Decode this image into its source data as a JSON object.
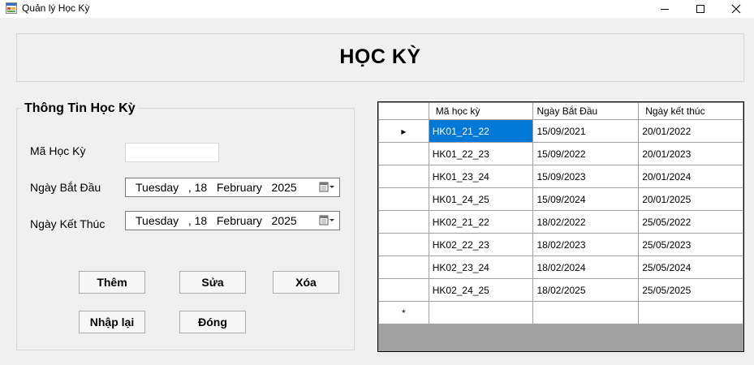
{
  "window": {
    "title": "Quản lý Học Kỳ",
    "icon": "app-form-icon"
  },
  "header": {
    "title": "HỌC KỲ"
  },
  "form": {
    "group_title": "Thông Tin Học Kỳ",
    "ma_hoc_ky_label": "Mã Học Kỳ",
    "ma_hoc_ky_value": "",
    "ngay_bat_dau_label": "Ngày Bắt Đầu",
    "ngay_bat_dau_value": "Tuesday   , 18   February   2025",
    "ngay_ket_thuc_label": "Ngày Kết Thúc",
    "ngay_ket_thuc_value": "Tuesday   , 18   February   2025"
  },
  "buttons": {
    "them": "Thêm",
    "sua": "Sửa",
    "xoa": "Xóa",
    "nhap_lai": "Nhập lại",
    "dong": "Đóng"
  },
  "grid": {
    "columns": [
      "Mã học kỳ",
      "Ngày Bắt Đầu",
      "Ngày kết thúc"
    ],
    "current_row_marker": "▸",
    "new_row_marker": "*",
    "rows": [
      [
        "HK01_21_22",
        "15/09/2021",
        "20/01/2022"
      ],
      [
        "HK01_22_23",
        "15/09/2022",
        "20/01/2023"
      ],
      [
        "HK01_23_24",
        "15/09/2023",
        "20/01/2024"
      ],
      [
        "HK01_24_25",
        "15/09/2024",
        "20/01/2025"
      ],
      [
        "HK02_21_22",
        "18/02/2022",
        "25/05/2022"
      ],
      [
        "HK02_22_23",
        "18/02/2023",
        "25/05/2023"
      ],
      [
        "HK02_23_24",
        "18/02/2024",
        "25/05/2024"
      ],
      [
        "HK02_24_25",
        "18/02/2025",
        "25/05/2025"
      ]
    ]
  }
}
